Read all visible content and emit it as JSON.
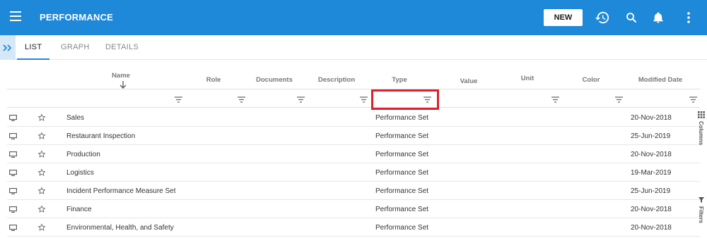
{
  "app": {
    "title": "PERFORMANCE",
    "new_label": "NEW"
  },
  "icons": {
    "menu": "hamburger-icon",
    "history": "history-icon",
    "search": "search-icon",
    "notifications": "bell-icon",
    "more": "more-vert-icon"
  },
  "tabs": [
    {
      "label": "LIST",
      "active": true
    },
    {
      "label": "GRAPH",
      "active": false
    },
    {
      "label": "DETAILS",
      "active": false
    }
  ],
  "columns": [
    "Name",
    "Role",
    "Documents",
    "Description",
    "Type",
    "Value",
    "Unit",
    "Color",
    "Modified Date"
  ],
  "rows": [
    {
      "name": "Sales",
      "type": "Performance Set",
      "modified": "20-Nov-2018"
    },
    {
      "name": "Restaurant Inspection",
      "type": "Performance Set",
      "modified": "25-Jun-2019"
    },
    {
      "name": "Production",
      "type": "Performance Set",
      "modified": "20-Nov-2018"
    },
    {
      "name": "Logistics",
      "type": "Performance Set",
      "modified": "19-Mar-2019"
    },
    {
      "name": "Incident Performance Measure Set",
      "type": "Performance Set",
      "modified": "25-Jun-2019"
    },
    {
      "name": "Finance",
      "type": "Performance Set",
      "modified": "20-Nov-2018"
    },
    {
      "name": "Environmental, Health, and Safety",
      "type": "Performance Set",
      "modified": "20-Nov-2018"
    }
  ],
  "side_panels": {
    "columns_label": "Columns",
    "filters_label": "Filters"
  },
  "colors": {
    "primary": "#1e88d9",
    "highlight": "#e0202a"
  }
}
